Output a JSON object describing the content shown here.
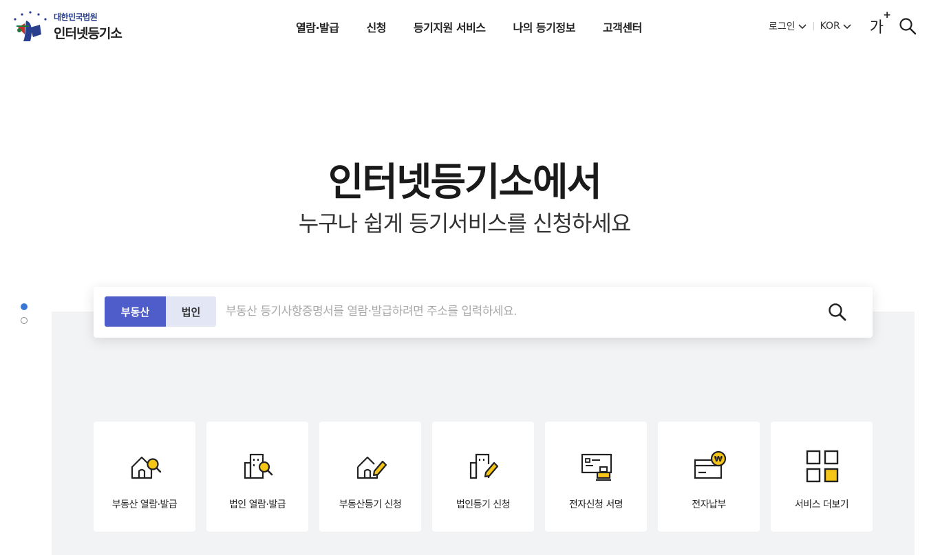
{
  "logo": {
    "org": "대한민국법원",
    "name": "인터넷등기소"
  },
  "nav": [
    {
      "label": "열람·발급"
    },
    {
      "label": "신청"
    },
    {
      "label": "등기지원 서비스"
    },
    {
      "label": "나의 등기정보"
    },
    {
      "label": "고객센터"
    }
  ],
  "util": {
    "login": "로그인",
    "lang": "KOR",
    "font_size": "가"
  },
  "hero": {
    "title": "인터넷등기소에서",
    "subtitle": "누구나 쉽게 등기서비스를 신청하세요"
  },
  "search": {
    "tabs": [
      "부동산",
      "법인"
    ],
    "active_tab": "부동산",
    "placeholder": "부동산 등기사항증명서를 열람·발급하려면 주소를 입력하세요.",
    "value": ""
  },
  "slider": {
    "count": 2,
    "active": 1
  },
  "services": [
    {
      "label": "부동산 열람·발급",
      "icon": "house-search-icon"
    },
    {
      "label": "법인 열람·발급",
      "icon": "building-search-icon"
    },
    {
      "label": "부동산등기 신청",
      "icon": "house-pen-icon"
    },
    {
      "label": "법인등기 신청",
      "icon": "building-pen-icon"
    },
    {
      "label": "전자신청 서명",
      "icon": "document-stamp-icon"
    },
    {
      "label": "전자납부",
      "icon": "card-won-icon"
    },
    {
      "label": "서비스 더보기",
      "icon": "grid-more-icon"
    }
  ],
  "colors": {
    "accent": "#4e5dc9",
    "accent_light": "#e3e6f5",
    "highlight": "#f5c518",
    "panel": "#f2f3f5",
    "dot_active": "#3a78d8"
  }
}
